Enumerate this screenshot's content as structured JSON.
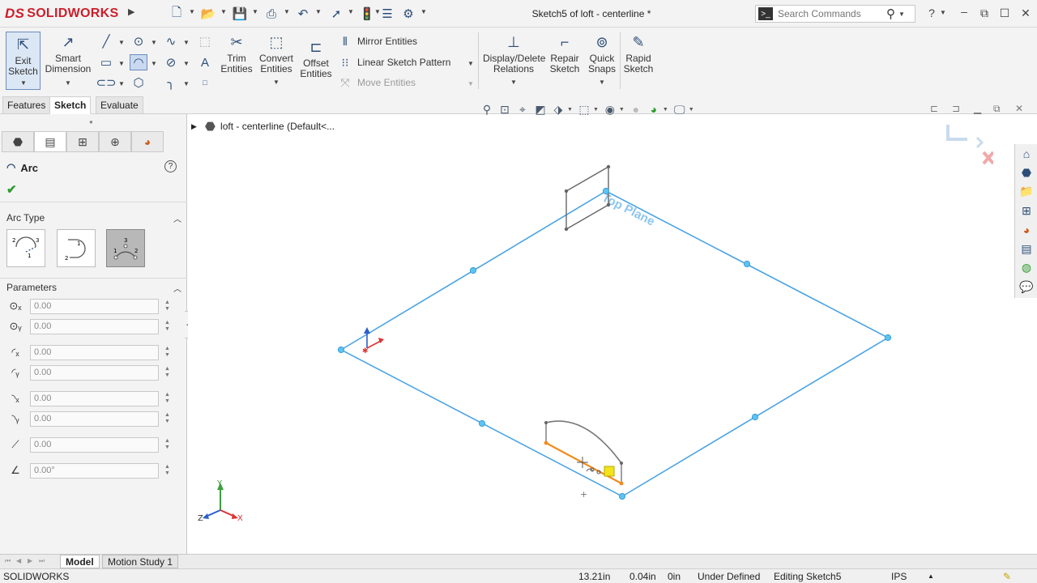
{
  "app": {
    "brand": "SOLIDWORKS",
    "brand_prefix": "DS"
  },
  "title_bar": {
    "document_title": "Sketch5 of loft - centerline *",
    "search_placeholder": "Search Commands",
    "icons": [
      "new-icon",
      "open-icon",
      "save-icon",
      "print-icon",
      "undo-icon",
      "select-icon",
      "rebuild-icon",
      "file-properties-icon",
      "options-icon"
    ]
  },
  "ribbon": {
    "exit_sketch": "Exit Sketch",
    "smart_dimension": "Smart Dimension",
    "trim_entities": "Trim Entities",
    "convert_entities": "Convert Entities",
    "offset_entities": "Offset Entities",
    "mirror_entities": "Mirror Entities",
    "linear_sketch_pattern": "Linear Sketch Pattern",
    "move_entities": "Move Entities",
    "display_delete_relations": "Display/Delete Relations",
    "repair_sketch": "Repair Sketch",
    "quick_snaps": "Quick Snaps",
    "rapid_sketch": "Rapid Sketch"
  },
  "command_tabs": [
    "Features",
    "Sketch",
    "Evaluate"
  ],
  "active_command_tab": "Sketch",
  "property_manager": {
    "title": "Arc",
    "arc_type_label": "Arc Type",
    "parameters_label": "Parameters",
    "selected_arc_type": "3 Point Arc",
    "parameters": [
      "0.00",
      "0.00",
      "0.00",
      "0.00",
      "0.00",
      "0.00",
      "0.00",
      "0.00°"
    ]
  },
  "graphics": {
    "tree_item": "loft - centerline  (Default<...",
    "plane_label": "Top Plane",
    "triad": {
      "x": "X",
      "y": "Y",
      "z": "Z"
    }
  },
  "bottom_tabs": [
    "Model",
    "Motion Study 1"
  ],
  "active_bottom_tab": "Model",
  "status_bar": {
    "app_name": "SOLIDWORKS",
    "x_coord": "13.21in",
    "y_coord": "0.04in",
    "z_coord": "0in",
    "definition": "Under Defined",
    "editing": "Editing Sketch5",
    "units": "IPS"
  },
  "colors": {
    "sketch_blue": "#4ba3e3",
    "sketch_point": "#5cc3f2",
    "selected_orange": "#f08c1e",
    "brand_red": "#cc1e2b"
  }
}
